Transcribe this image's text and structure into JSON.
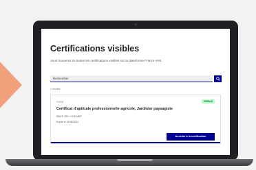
{
  "page": {
    "title": "Certifications visibles",
    "subtitle": "Vous trouverez ici toutes les certifications visibles sur la plateforme France VAE."
  },
  "search": {
    "value": "Rechercher",
    "button_icon": "search-icon"
  },
  "results": {
    "count_label": "1 résultat"
  },
  "certification_card": {
    "code": "CODE",
    "status_badge": "VISIBLE",
    "title": "Certificat d'aptitude professionnelle agricole, Jardinier paysagiste",
    "line1": "RNCP / RS / CCN MRP",
    "line2": "Expire le 31/08/2024",
    "cta_label": "Accéder à la certification"
  },
  "colors": {
    "accent": "#000091",
    "arrow": "#f0a07a",
    "badge_bg": "#b8fec9",
    "badge_text": "#18753c"
  }
}
